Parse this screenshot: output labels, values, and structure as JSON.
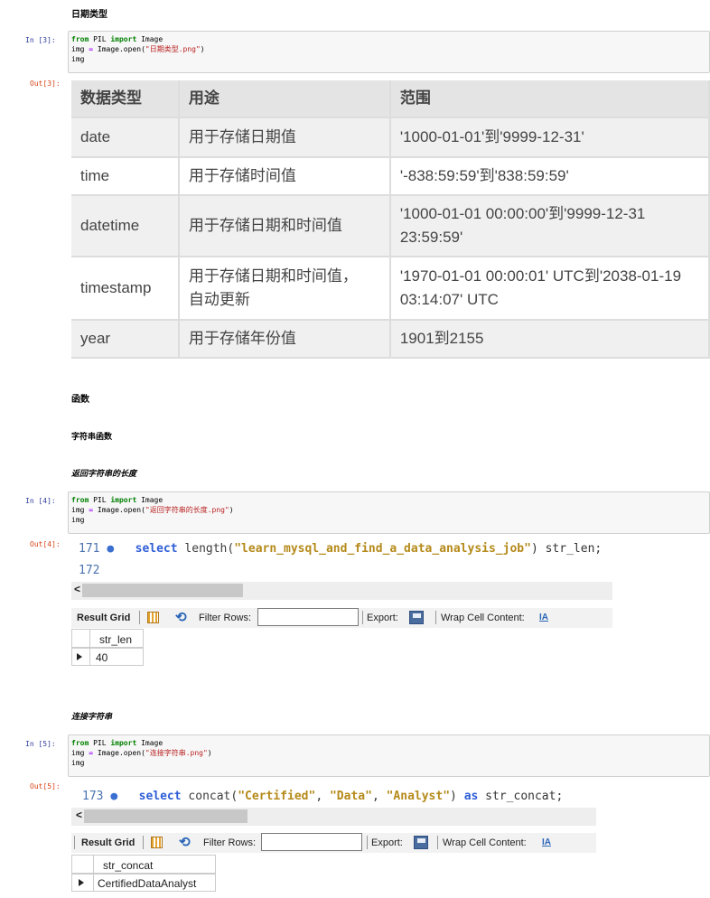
{
  "headings": {
    "date_types": "日期类型",
    "functions": "函数",
    "string_functions": "字符串函数",
    "string_length": "返回字符串的长度",
    "concat": "连接字符串"
  },
  "cells": [
    {
      "in_prompt": "In  [3]:",
      "out_prompt": "Out[3]:",
      "code": [
        [
          {
            "t": "from",
            "c": "kw"
          },
          {
            "t": " PIL ",
            "c": ""
          },
          {
            "t": "import",
            "c": "kw"
          },
          {
            "t": " Image",
            "c": ""
          }
        ],
        [
          {
            "t": "img ",
            "c": ""
          },
          {
            "t": "=",
            "c": "op"
          },
          {
            "t": " Image.open(",
            "c": ""
          },
          {
            "t": "\"日期类型.png\"",
            "c": "str"
          },
          {
            "t": ")",
            "c": ""
          }
        ],
        [
          {
            "t": "img",
            "c": ""
          }
        ]
      ]
    },
    {
      "in_prompt": "In  [4]:",
      "out_prompt": "Out[4]:",
      "code": [
        [
          {
            "t": "from",
            "c": "kw"
          },
          {
            "t": " PIL ",
            "c": ""
          },
          {
            "t": "import",
            "c": "kw"
          },
          {
            "t": " Image",
            "c": ""
          }
        ],
        [
          {
            "t": "img ",
            "c": ""
          },
          {
            "t": "=",
            "c": "op"
          },
          {
            "t": " Image.open(",
            "c": ""
          },
          {
            "t": "\"返回字符串的长度.png\"",
            "c": "str"
          },
          {
            "t": ")",
            "c": ""
          }
        ],
        [
          {
            "t": "img",
            "c": ""
          }
        ]
      ]
    },
    {
      "in_prompt": "In  [5]:",
      "out_prompt": "Out[5]:",
      "code": [
        [
          {
            "t": "from",
            "c": "kw"
          },
          {
            "t": " PIL ",
            "c": ""
          },
          {
            "t": "import",
            "c": "kw"
          },
          {
            "t": " Image",
            "c": ""
          }
        ],
        [
          {
            "t": "img ",
            "c": ""
          },
          {
            "t": "=",
            "c": "op"
          },
          {
            "t": " Image.open(",
            "c": ""
          },
          {
            "t": "\"连接字符串.png\"",
            "c": "str"
          },
          {
            "t": ")",
            "c": ""
          }
        ],
        [
          {
            "t": "img",
            "c": ""
          }
        ]
      ]
    }
  ],
  "date_table": {
    "headers": [
      "数据类型",
      "用途",
      "范围"
    ],
    "rows": [
      {
        "type": "date",
        "use": [
          "用于存储日期值"
        ],
        "range": [
          "'1000-01-01'到'9999-12-31'"
        ]
      },
      {
        "type": "time",
        "use": [
          "用于存储时间值"
        ],
        "range": [
          "'-838:59:59'到'838:59:59'"
        ]
      },
      {
        "type": "datetime",
        "use": [
          "用于存储日期和时间值"
        ],
        "range": [
          "'1000-01-01 00:00:00'到'9999-12-31",
          "23:59:59'"
        ]
      },
      {
        "type": "timestamp",
        "use": [
          "用于存储日期和时间值，",
          "自动更新"
        ],
        "range": [
          "'1970-01-01 00:00:01' UTC到'2038-01-19",
          "03:14:07' UTC"
        ]
      },
      {
        "type": "year",
        "use": [
          "用于存储年份值"
        ],
        "range": [
          "1901到2155"
        ]
      }
    ]
  },
  "wb1": {
    "lines": [
      {
        "num": "171",
        "dot": "●",
        "tokens": [
          {
            "t": "select ",
            "c": "skw"
          },
          {
            "t": "length(",
            "c": "sfn"
          },
          {
            "t": "\"learn_mysql_and_find_a_data_analysis_job\"",
            "c": "sstr"
          },
          {
            "t": ") str_len;",
            "c": "srest"
          }
        ]
      },
      {
        "num": "172",
        "dot": "",
        "tokens": []
      }
    ],
    "scroll_left": "<",
    "result_grid": "Result Grid",
    "filter_rows": "Filter Rows:",
    "export": "Export:",
    "wrap": "Wrap Cell Content:",
    "column": "str_len",
    "value": "40"
  },
  "wb2": {
    "lines": [
      {
        "num": "173",
        "dot": "●",
        "tokens": [
          {
            "t": "select ",
            "c": "skw"
          },
          {
            "t": "concat(",
            "c": "sfn"
          },
          {
            "t": "\"Certified\"",
            "c": "sstr"
          },
          {
            "t": ", ",
            "c": "srest"
          },
          {
            "t": "\"Data\"",
            "c": "sstr"
          },
          {
            "t": ", ",
            "c": "srest"
          },
          {
            "t": "\"Analyst\"",
            "c": "sstr"
          },
          {
            "t": ") ",
            "c": "srest"
          },
          {
            "t": "as",
            "c": "skw"
          },
          {
            "t": " str_concat;",
            "c": "srest"
          }
        ]
      }
    ],
    "scroll_left": "<",
    "result_grid": "Result Grid",
    "filter_rows": "Filter Rows:",
    "export": "Export:",
    "wrap": "Wrap Cell Content:",
    "column": "str_concat",
    "value": "CertifiedDataAnalyst"
  },
  "icons": {
    "grid": "grid-icon",
    "refresh": "refresh-icon",
    "export": "save-icon",
    "wrap": "wrap-text-icon",
    "row_pointer": "row-pointer-icon"
  }
}
